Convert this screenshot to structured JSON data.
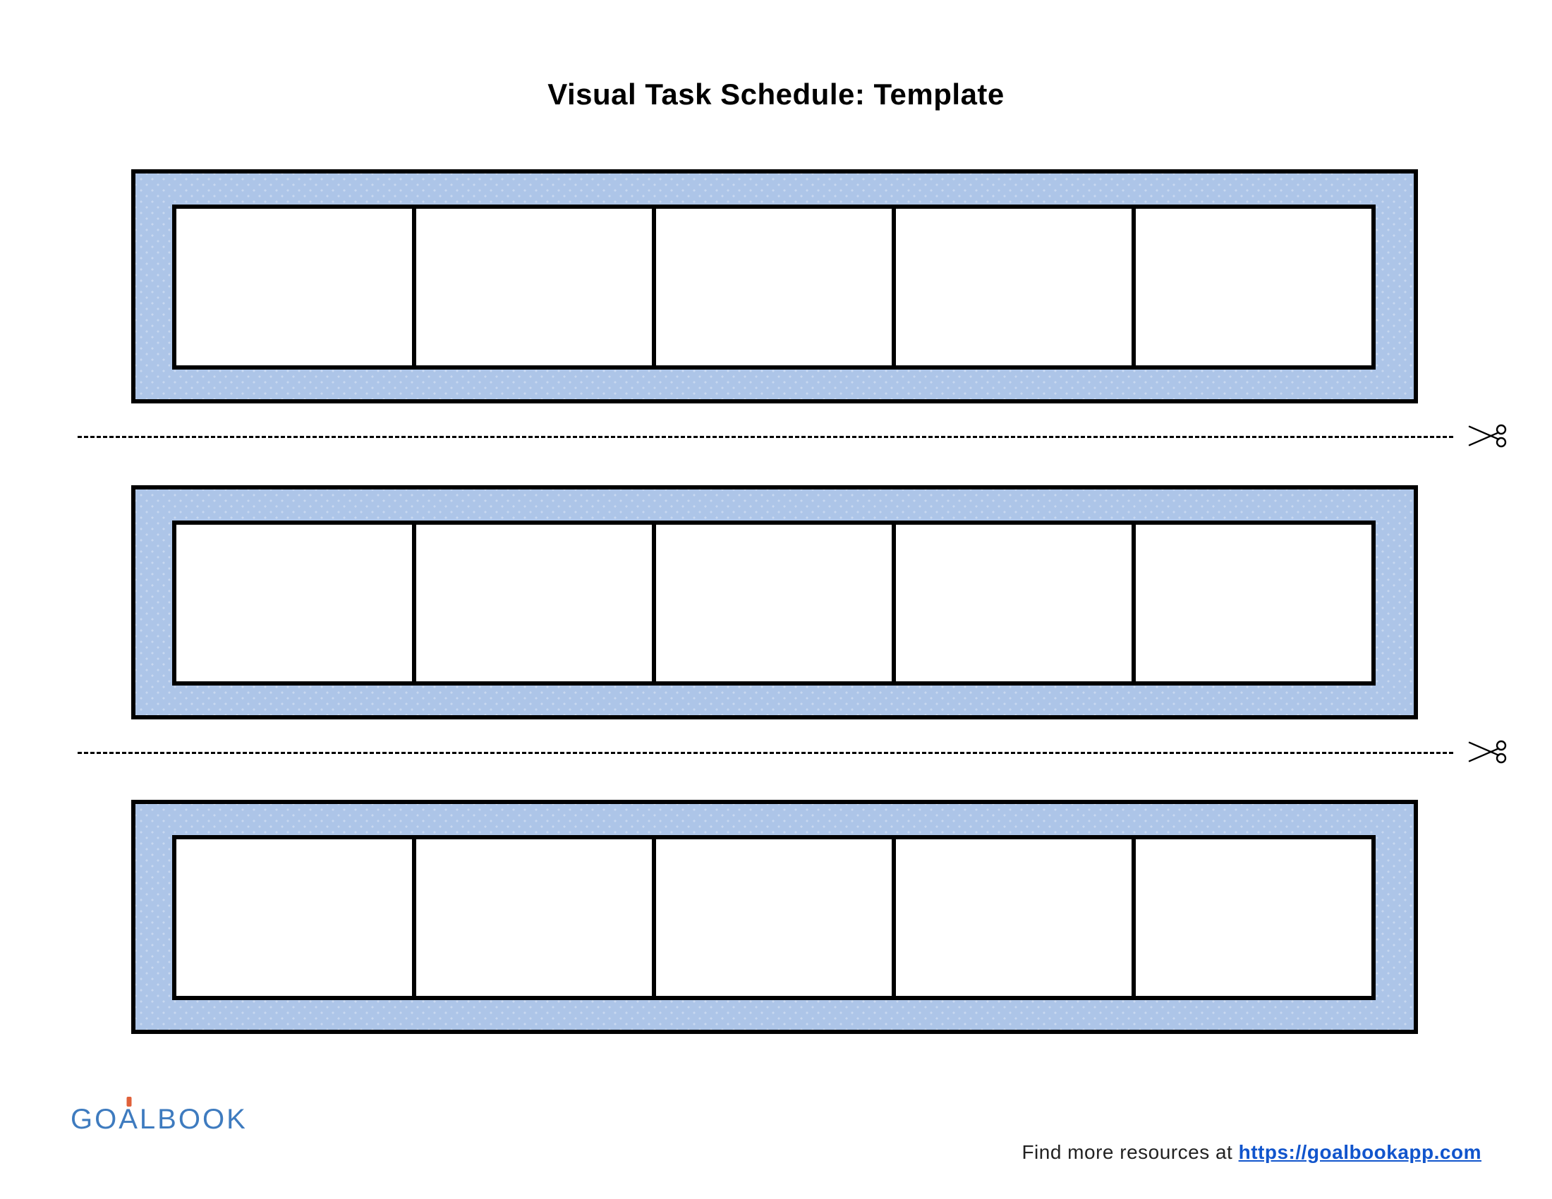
{
  "title": "Visual Task Schedule: Template",
  "strips": {
    "count": 3,
    "cellsPerStrip": 5
  },
  "colors": {
    "band": "#adc5e8",
    "ink": "#000000",
    "logoBlue": "#3e7bbf",
    "logoAccent": "#e0613a",
    "link": "#1155cc"
  },
  "footer": {
    "resourcesLabel": "Find more resources at ",
    "url": "https://goalbookapp.com"
  },
  "logo": {
    "pre": "GO",
    "accent": "A",
    "post": "LBOOK"
  },
  "layout": {
    "stripTops": [
      240,
      688,
      1134
    ],
    "cutTops": [
      618,
      1066
    ],
    "cellW": 346,
    "cellH": 234,
    "rowLeft": 52,
    "rowTop": 44
  }
}
